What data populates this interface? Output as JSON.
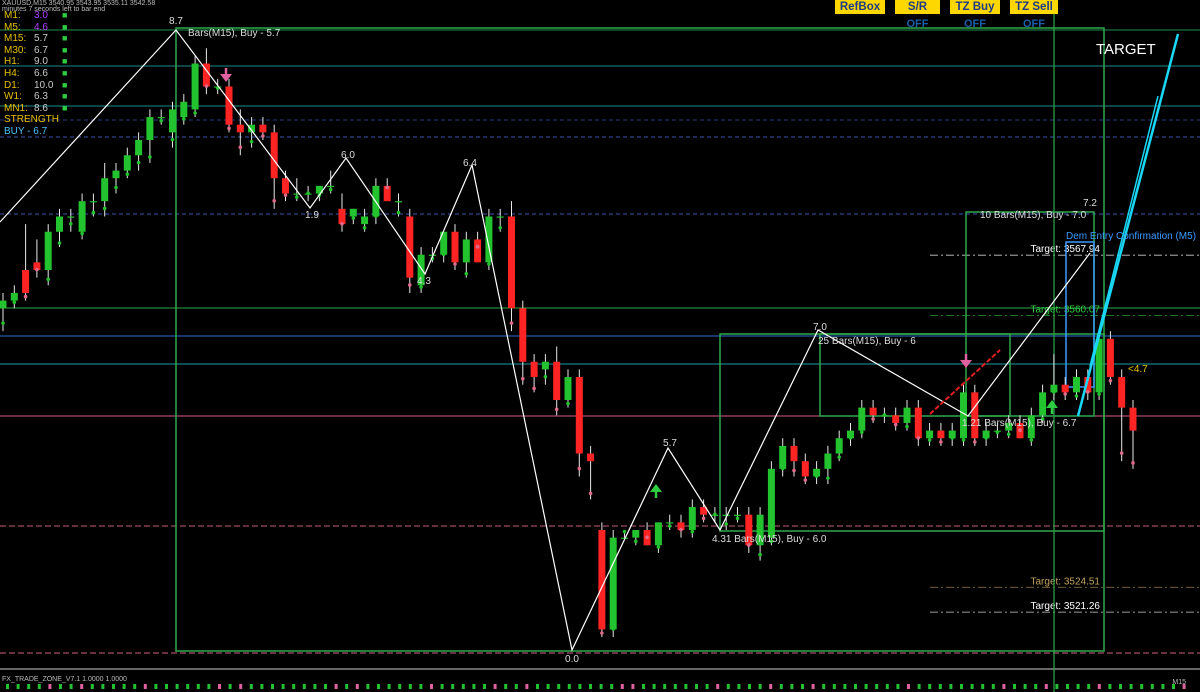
{
  "header": {
    "symbol_line": "XAUUSD,M15 3540.95 3543.95 3535.11 3542.58",
    "countdown": "minutes 7 seconds left to bar end"
  },
  "timeframes": [
    {
      "name": "M1:",
      "value": "3.0",
      "color": "#b040ff"
    },
    {
      "name": "M5:",
      "value": "4.6",
      "color": "#b040ff"
    },
    {
      "name": "M15:",
      "value": "5.7",
      "color": "#c8c8c8"
    },
    {
      "name": "M30:",
      "value": "6.7",
      "color": "#c8c8c8"
    },
    {
      "name": "H1:",
      "value": "9.0",
      "color": "#c8c8c8"
    },
    {
      "name": "H4:",
      "value": "6.6",
      "color": "#c8c8c8"
    },
    {
      "name": "D1:",
      "value": "10.0",
      "color": "#c8c8c8"
    },
    {
      "name": "W1:",
      "value": "6.3",
      "color": "#c8c8c8"
    },
    {
      "name": "MN1:",
      "value": "8.6",
      "color": "#c8c8c8"
    }
  ],
  "strength_label": "STRENGTH",
  "buy_label": "BUY - 6.7",
  "buttons": [
    {
      "label": "RefBox",
      "state": ""
    },
    {
      "label": "S/R",
      "state": "OFF"
    },
    {
      "label": "TZ Buy",
      "state": "OFF"
    },
    {
      "label": "TZ Sell",
      "state": "OFF"
    }
  ],
  "footer_label": "FX_TRADE_ZONE_V7.1 1.0000 1.0000",
  "timeframe_label": "M15",
  "target_label": "TARGET",
  "chart_data": {
    "type": "candlestick",
    "ylim": [
      3515,
      3600
    ],
    "candles": [
      {
        "o": 3561,
        "h": 3563,
        "l": 3558,
        "c": 3562
      },
      {
        "o": 3562,
        "h": 3564,
        "l": 3561,
        "c": 3563
      },
      {
        "o": 3566,
        "h": 3572,
        "l": 3562,
        "c": 3563
      },
      {
        "o": 3567,
        "h": 3570,
        "l": 3565,
        "c": 3566
      },
      {
        "o": 3566,
        "h": 3572,
        "l": 3564,
        "c": 3571
      },
      {
        "o": 3571,
        "h": 3574,
        "l": 3569,
        "c": 3573
      },
      {
        "o": 3573,
        "h": 3574,
        "l": 3571,
        "c": 3573
      },
      {
        "o": 3571,
        "h": 3576,
        "l": 3570,
        "c": 3575
      },
      {
        "o": 3575,
        "h": 3576,
        "l": 3573,
        "c": 3575
      },
      {
        "o": 3575,
        "h": 3580,
        "l": 3573,
        "c": 3578
      },
      {
        "o": 3578,
        "h": 3580,
        "l": 3576,
        "c": 3579
      },
      {
        "o": 3579,
        "h": 3582,
        "l": 3578,
        "c": 3581
      },
      {
        "o": 3581,
        "h": 3584,
        "l": 3579,
        "c": 3583
      },
      {
        "o": 3583,
        "h": 3587,
        "l": 3580,
        "c": 3586
      },
      {
        "o": 3586,
        "h": 3587,
        "l": 3585,
        "c": 3586
      },
      {
        "o": 3584,
        "h": 3588,
        "l": 3582,
        "c": 3587
      },
      {
        "o": 3586,
        "h": 3589,
        "l": 3585,
        "c": 3588
      },
      {
        "o": 3587,
        "h": 3594,
        "l": 3586,
        "c": 3593
      },
      {
        "o": 3593,
        "h": 3595,
        "l": 3589,
        "c": 3590
      },
      {
        "o": 3590,
        "h": 3591,
        "l": 3589,
        "c": 3590
      },
      {
        "o": 3590,
        "h": 3591,
        "l": 3584,
        "c": 3585
      },
      {
        "o": 3585,
        "h": 3587,
        "l": 3581,
        "c": 3584
      },
      {
        "o": 3584,
        "h": 3586,
        "l": 3582,
        "c": 3585
      },
      {
        "o": 3585,
        "h": 3586,
        "l": 3583,
        "c": 3584
      },
      {
        "o": 3584,
        "h": 3585,
        "l": 3574,
        "c": 3578
      },
      {
        "o": 3578,
        "h": 3579,
        "l": 3575,
        "c": 3576
      },
      {
        "o": 3576,
        "h": 3578,
        "l": 3575,
        "c": 3576
      },
      {
        "o": 3576,
        "h": 3577,
        "l": 3575,
        "c": 3576
      },
      {
        "o": 3576,
        "h": 3577,
        "l": 3575,
        "c": 3577
      },
      {
        "o": 3577,
        "h": 3579,
        "l": 3576,
        "c": 3577
      },
      {
        "o": 3574,
        "h": 3576,
        "l": 3571,
        "c": 3572
      },
      {
        "o": 3573,
        "h": 3574,
        "l": 3572,
        "c": 3574
      },
      {
        "o": 3572,
        "h": 3574,
        "l": 3571,
        "c": 3573
      },
      {
        "o": 3573,
        "h": 3578,
        "l": 3572,
        "c": 3577
      },
      {
        "o": 3577,
        "h": 3578,
        "l": 3576,
        "c": 3575
      },
      {
        "o": 3575,
        "h": 3576,
        "l": 3573,
        "c": 3575
      },
      {
        "o": 3573,
        "h": 3574,
        "l": 3563,
        "c": 3565
      },
      {
        "o": 3564,
        "h": 3569,
        "l": 3563,
        "c": 3568
      },
      {
        "o": 3568,
        "h": 3569,
        "l": 3567,
        "c": 3568
      },
      {
        "o": 3568,
        "h": 3571,
        "l": 3567,
        "c": 3571
      },
      {
        "o": 3571,
        "h": 3572,
        "l": 3566,
        "c": 3567
      },
      {
        "o": 3567,
        "h": 3571,
        "l": 3565,
        "c": 3570
      },
      {
        "o": 3570,
        "h": 3571,
        "l": 3568,
        "c": 3567
      },
      {
        "o": 3567,
        "h": 3574,
        "l": 3566,
        "c": 3573
      },
      {
        "o": 3573,
        "h": 3574,
        "l": 3571,
        "c": 3573
      },
      {
        "o": 3573,
        "h": 3575,
        "l": 3558,
        "c": 3561
      },
      {
        "o": 3561,
        "h": 3562,
        "l": 3551,
        "c": 3554
      },
      {
        "o": 3554,
        "h": 3555,
        "l": 3550,
        "c": 3552
      },
      {
        "o": 3553,
        "h": 3555,
        "l": 3551,
        "c": 3554
      },
      {
        "o": 3554,
        "h": 3556,
        "l": 3547,
        "c": 3549
      },
      {
        "o": 3549,
        "h": 3553,
        "l": 3548,
        "c": 3552
      },
      {
        "o": 3552,
        "h": 3553,
        "l": 3539,
        "c": 3542
      },
      {
        "o": 3542,
        "h": 3543,
        "l": 3536,
        "c": 3541
      },
      {
        "o": 3532,
        "h": 3533,
        "l": 3518,
        "c": 3519
      },
      {
        "o": 3519,
        "h": 3532,
        "l": 3518,
        "c": 3531
      },
      {
        "o": 3531,
        "h": 3532,
        "l": 3531,
        "c": 3531
      },
      {
        "o": 3531,
        "h": 3532,
        "l": 3530,
        "c": 3532
      },
      {
        "o": 3532,
        "h": 3533,
        "l": 3530,
        "c": 3530
      },
      {
        "o": 3530,
        "h": 3533,
        "l": 3529,
        "c": 3533
      },
      {
        "o": 3533,
        "h": 3534,
        "l": 3532,
        "c": 3533
      },
      {
        "o": 3533,
        "h": 3534,
        "l": 3531,
        "c": 3532
      },
      {
        "o": 3532,
        "h": 3536,
        "l": 3531,
        "c": 3535
      },
      {
        "o": 3535,
        "h": 3536,
        "l": 3533,
        "c": 3534
      },
      {
        "o": 3534,
        "h": 3535,
        "l": 3533,
        "c": 3534
      },
      {
        "o": 3534,
        "h": 3535,
        "l": 3532,
        "c": 3534
      },
      {
        "o": 3534,
        "h": 3535,
        "l": 3533,
        "c": 3534
      },
      {
        "o": 3534,
        "h": 3535,
        "l": 3529,
        "c": 3530
      },
      {
        "o": 3530,
        "h": 3535,
        "l": 3528,
        "c": 3534
      },
      {
        "o": 3531,
        "h": 3541,
        "l": 3530,
        "c": 3540
      },
      {
        "o": 3540,
        "h": 3544,
        "l": 3539,
        "c": 3543
      },
      {
        "o": 3543,
        "h": 3544,
        "l": 3539,
        "c": 3541
      },
      {
        "o": 3541,
        "h": 3542,
        "l": 3538,
        "c": 3539
      },
      {
        "o": 3539,
        "h": 3541,
        "l": 3538,
        "c": 3540
      },
      {
        "o": 3540,
        "h": 3543,
        "l": 3538,
        "c": 3542
      },
      {
        "o": 3542,
        "h": 3545,
        "l": 3541,
        "c": 3544
      },
      {
        "o": 3544,
        "h": 3546,
        "l": 3543,
        "c": 3545
      },
      {
        "o": 3545,
        "h": 3549,
        "l": 3544,
        "c": 3548
      },
      {
        "o": 3548,
        "h": 3549,
        "l": 3546,
        "c": 3547
      },
      {
        "o": 3547,
        "h": 3548,
        "l": 3546,
        "c": 3547
      },
      {
        "o": 3547,
        "h": 3548,
        "l": 3545,
        "c": 3546
      },
      {
        "o": 3546,
        "h": 3549,
        "l": 3545,
        "c": 3548
      },
      {
        "o": 3548,
        "h": 3549,
        "l": 3543,
        "c": 3544
      },
      {
        "o": 3544,
        "h": 3546,
        "l": 3543,
        "c": 3545
      },
      {
        "o": 3545,
        "h": 3546,
        "l": 3543,
        "c": 3544
      },
      {
        "o": 3544,
        "h": 3546,
        "l": 3543,
        "c": 3545
      },
      {
        "o": 3544,
        "h": 3551,
        "l": 3543,
        "c": 3550
      },
      {
        "o": 3550,
        "h": 3551,
        "l": 3543,
        "c": 3544
      },
      {
        "o": 3544,
        "h": 3546,
        "l": 3543,
        "c": 3545
      },
      {
        "o": 3545,
        "h": 3546,
        "l": 3544,
        "c": 3545
      },
      {
        "o": 3545,
        "h": 3547,
        "l": 3544,
        "c": 3546
      },
      {
        "o": 3546,
        "h": 3547,
        "l": 3544,
        "c": 3544
      },
      {
        "o": 3544,
        "h": 3548,
        "l": 3543,
        "c": 3547
      },
      {
        "o": 3547,
        "h": 3551,
        "l": 3546,
        "c": 3550
      },
      {
        "o": 3550,
        "h": 3555,
        "l": 3549,
        "c": 3551
      },
      {
        "o": 3551,
        "h": 3552,
        "l": 3549,
        "c": 3550
      },
      {
        "o": 3550,
        "h": 3553,
        "l": 3549,
        "c": 3552
      },
      {
        "o": 3552,
        "h": 3553,
        "l": 3549,
        "c": 3550
      },
      {
        "o": 3550,
        "h": 3558,
        "l": 3549,
        "c": 3557
      },
      {
        "o": 3557,
        "h": 3558,
        "l": 3551,
        "c": 3552
      },
      {
        "o": 3552,
        "h": 3553,
        "l": 3541,
        "c": 3548
      },
      {
        "o": 3548,
        "h": 3549,
        "l": 3540,
        "c": 3545
      }
    ],
    "horizontal_levels": [
      {
        "value": 3567.94,
        "label": "Target: 3567.94",
        "color": "#ffffff",
        "style": "dashdot"
      },
      {
        "value": 3560.07,
        "label": "Target: 3560.07",
        "color": "#2ecc40",
        "style": "dashdot"
      },
      {
        "value": 3524.51,
        "label": "Target: 3524.51",
        "color": "#c0a060",
        "style": "dashdot"
      },
      {
        "value": 3521.26,
        "label": "Target: 3521.26",
        "color": "#ffffff",
        "style": "dashdot"
      }
    ],
    "pivot_labels": [
      {
        "text": "8.7"
      },
      {
        "text": "Bars(M15), Buy - 5.7"
      },
      {
        "text": "6.0"
      },
      {
        "text": "1.9"
      },
      {
        "text": "6.4"
      },
      {
        "text": "4.3"
      },
      {
        "text": "0.0"
      },
      {
        "text": "5.7"
      },
      {
        "text": "4.31 Bars(M15), Buy - 6.0"
      },
      {
        "text": "7.0"
      },
      {
        "text": "25 Bars(M15), Buy - 6"
      },
      {
        "text": "1.21 Bars(M15), Buy - 6.7"
      },
      {
        "text": "7.2"
      },
      {
        "text": "10 Bars(M15), Buy - 7.0"
      },
      {
        "text": "Dem Entry Confirmation (M5)"
      },
      {
        "text": "<4.7"
      }
    ]
  }
}
